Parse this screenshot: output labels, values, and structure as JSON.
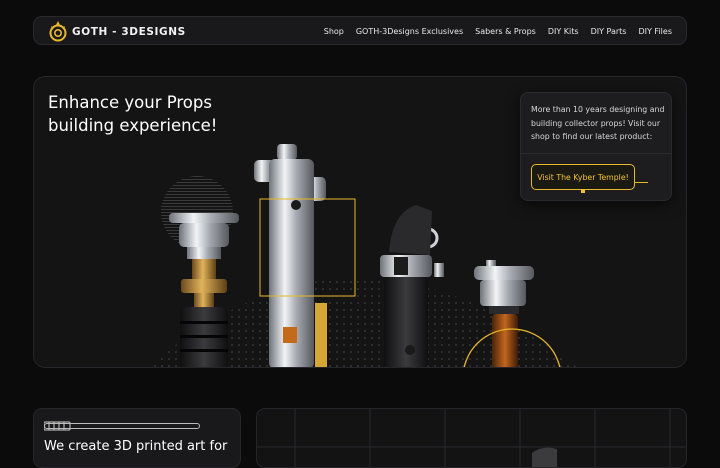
{
  "header": {
    "logo_text": "GOTH - 3DESIGNS",
    "nav": [
      {
        "label": "Shop"
      },
      {
        "label": "GOTH-3Designs Exclusives"
      },
      {
        "label": "Sabers & Props"
      },
      {
        "label": "DIY Kits"
      },
      {
        "label": "DIY Parts"
      },
      {
        "label": "DIY Files"
      }
    ]
  },
  "hero": {
    "title": "Enhance your Props building experience!",
    "info_text": "More than 10 years designing and building collector props! Visit our shop to find our latest product:",
    "cta_label": "Visit The Kyber Temple!"
  },
  "bottom_left": {
    "title": "We create 3D printed art for"
  },
  "colors": {
    "accent": "#e7b82a",
    "background": "#0b0b0c",
    "card": "#141415"
  }
}
